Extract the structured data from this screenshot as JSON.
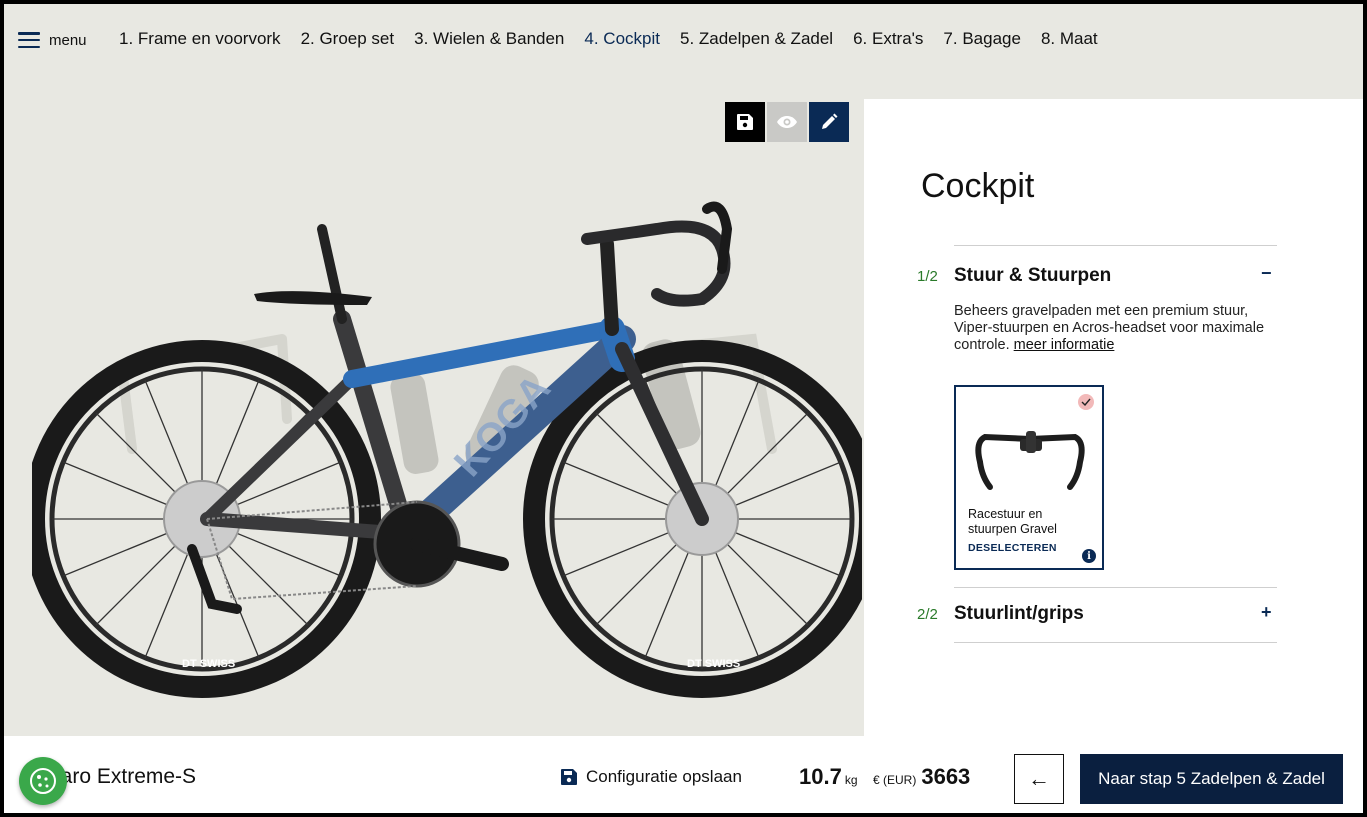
{
  "nav": {
    "menu_label": "menu",
    "steps": [
      {
        "label": "1. Frame en voorvork"
      },
      {
        "label": "2. Groep set"
      },
      {
        "label": "3. Wielen & Banden"
      },
      {
        "label": "4. Cockpit",
        "active": true
      },
      {
        "label": "5. Zadelpen & Zadel"
      },
      {
        "label": "6. Extra's"
      },
      {
        "label": "7. Bagage"
      },
      {
        "label": "8. Maat"
      }
    ]
  },
  "toolbar": {
    "icons": [
      "save-icon",
      "eye-icon",
      "pencil-icon"
    ]
  },
  "bike_image": {
    "brand_text": "KOGA",
    "rim_text": "DT SWISS"
  },
  "panel": {
    "title": "Cockpit",
    "sections": [
      {
        "num": "1/2",
        "title": "Stuur & Stuurpen",
        "toggle": "−",
        "expanded": true,
        "description": "Beheers gravelpaden met een premium stuur, Viper-stuurpen en Acros-headset voor maximale controle.",
        "more_link": "meer informatie",
        "option": {
          "name": "Racestuur en stuurpen Gravel",
          "action": "DESELECTEREN",
          "selected": true
        }
      },
      {
        "num": "2/2",
        "title": "Stuurlint/grips",
        "toggle": "+",
        "expanded": false
      }
    ]
  },
  "footer": {
    "model_name": "naro Extreme-S",
    "save_config": "Configuratie opslaan",
    "weight_value": "10.7",
    "weight_unit": "kg",
    "currency": "€ (EUR)",
    "price": "3663",
    "back_arrow": "←",
    "next_label": "Naar stap 5 Zadelpen & Zadel"
  },
  "colors": {
    "navy": "#0a2a55",
    "nav_bg": "#e8e8e2",
    "counter_green": "#2a7a2a",
    "cookie_green": "#3aa84a",
    "frame_blue": "#2f6fb8"
  }
}
